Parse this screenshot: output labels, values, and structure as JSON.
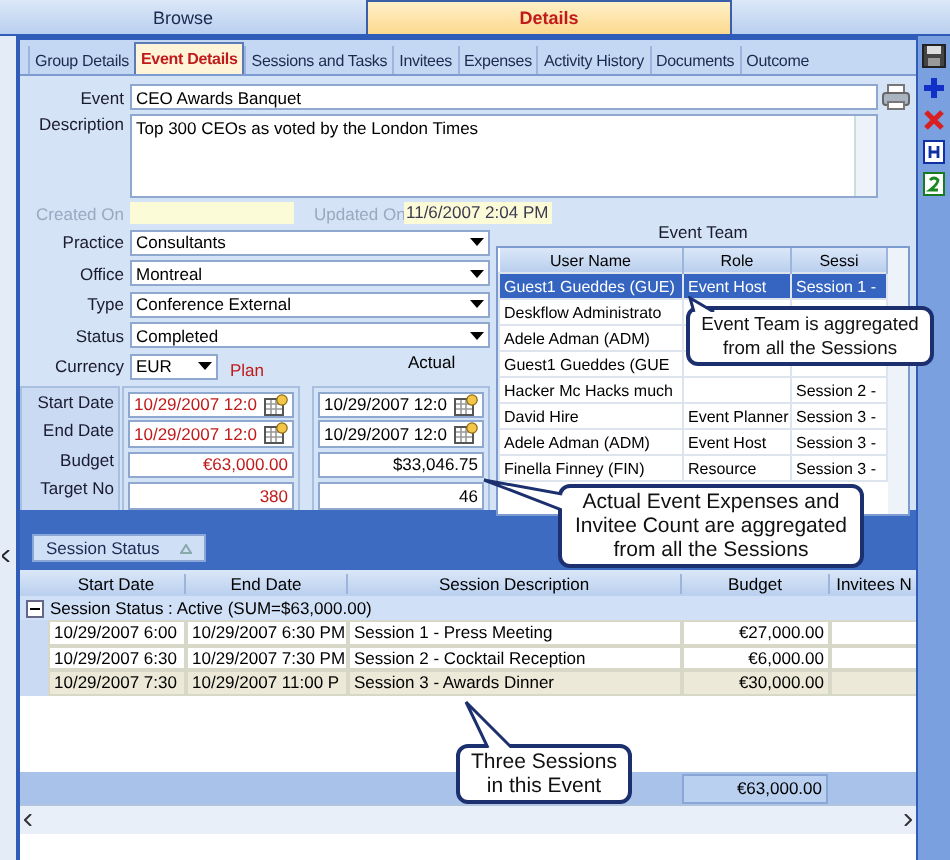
{
  "top_tabs": [
    {
      "label": "Browse",
      "selected": false
    },
    {
      "label": "Details",
      "selected": true
    }
  ],
  "tabs": [
    {
      "label": "Group Details",
      "selected": false
    },
    {
      "label": "Event Details",
      "selected": true
    },
    {
      "label": "Sessions and Tasks",
      "selected": false
    },
    {
      "label": "Invitees",
      "selected": false
    },
    {
      "label": "Expenses",
      "selected": false
    },
    {
      "label": "Activity History",
      "selected": false
    },
    {
      "label": "Documents",
      "selected": false
    },
    {
      "label": "Outcome",
      "selected": false
    }
  ],
  "form": {
    "event": {
      "label": "Event",
      "value": "CEO Awards Banquet"
    },
    "description": {
      "label": "Description",
      "value": "Top 300 CEOs as voted by the London Times"
    },
    "created_on": {
      "label": "Created On"
    },
    "updated_on": {
      "label": "Updated On",
      "value": "11/6/2007 2:04 PM"
    },
    "dropdowns": [
      {
        "label": "Practice",
        "value": "Consultants"
      },
      {
        "label": "Office",
        "value": "Montreal"
      },
      {
        "label": "Type",
        "value": "Conference External"
      },
      {
        "label": "Status",
        "value": "Completed"
      }
    ],
    "currency": {
      "label": "Currency",
      "value": "EUR"
    }
  },
  "figures": {
    "row_labels": [
      "Start Date",
      "End Date",
      "Budget",
      "Target No"
    ],
    "plan": {
      "title": "Plan",
      "start_date": "10/29/2007 12:0",
      "end_date": "10/29/2007 12:0",
      "budget": "€63,000.00",
      "target": "380"
    },
    "actual": {
      "title": "Actual",
      "start_date": "10/29/2007 12:0",
      "end_date": "10/29/2007 12:0",
      "budget": "$33,046.75",
      "target": "46"
    }
  },
  "event_team": {
    "title": "Event Team",
    "columns": [
      "User Name",
      "Role",
      "Sessi"
    ],
    "rows": [
      {
        "user": "Guest1 Gueddes (GUE)",
        "role": "Event Host",
        "session": "Session 1 -",
        "selected": true
      },
      {
        "user": "Deskflow Administrato",
        "selected": false
      },
      {
        "user": "Adele Adman (ADM)",
        "selected": false
      },
      {
        "user": "Guest1 Gueddes (GUE",
        "selected": false
      },
      {
        "user": "Hacker Mc Hacks much",
        "session": "Session 2 -",
        "selected": false
      },
      {
        "user": "David Hire",
        "role": "Event Planner",
        "session": "Session 3 -",
        "selected": false
      },
      {
        "user": "Adele Adman (ADM)",
        "role": "Event Host",
        "session": "Session 3 -",
        "selected": false
      },
      {
        "user": "Finella Finney (FIN)",
        "role": "Resource",
        "session": "Session 3 -",
        "selected": false
      }
    ]
  },
  "sessions": {
    "group_button": "Session Status",
    "columns": [
      "Start Date",
      "End Date",
      "Session Description",
      "Budget",
      "Invitees N"
    ],
    "group": {
      "text": "Session Status : Active (SUM=$63,000.00)",
      "expanded": true
    },
    "rows": [
      {
        "start": "10/29/2007 6:00",
        "end": "10/29/2007 6:30 PM",
        "description": "Session 1 - Press Meeting",
        "budget": "€27,000.00",
        "selected": false
      },
      {
        "start": "10/29/2007 6:30",
        "end": "10/29/2007 7:30 PM",
        "description": "Session 2 - Cocktail Reception",
        "budget": "€6,000.00",
        "selected": false
      },
      {
        "start": "10/29/2007 7:30",
        "end": "10/29/2007 11:00 P",
        "description": "Session 3 - Awards Dinner",
        "budget": "€30,000.00",
        "selected": true
      }
    ],
    "total": "€63,000.00"
  },
  "callouts": [
    {
      "kind": "left",
      "text": "Event Team is aggregated from all the Sessions"
    },
    {
      "kind": "left",
      "text": "Actual Event Expenses and Invitee Count are aggregated from all the Sessions"
    },
    {
      "kind": "up",
      "text": "Three Sessions in this Event"
    }
  ]
}
